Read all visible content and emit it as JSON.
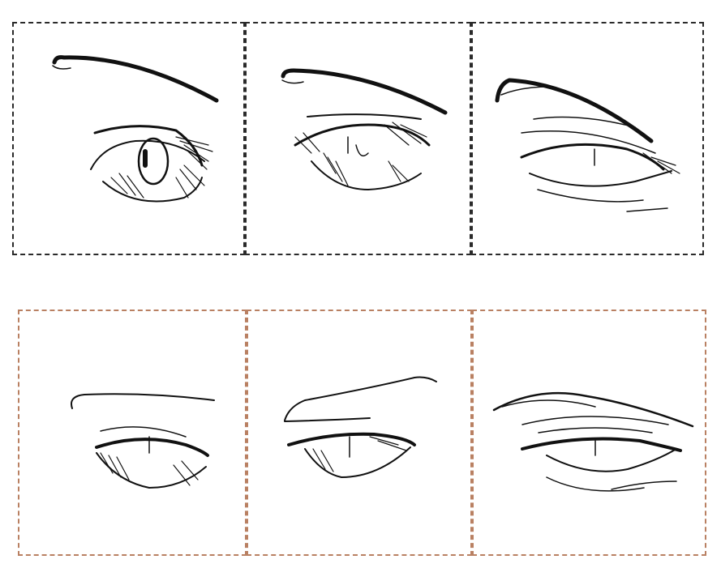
{
  "panels": [
    {
      "name": "eye-sketch-1",
      "row": "top",
      "description_icon": "eye-icon"
    },
    {
      "name": "eye-sketch-2",
      "row": "top",
      "description_icon": "eye-icon"
    },
    {
      "name": "eye-sketch-3",
      "row": "top",
      "description_icon": "eye-icon"
    },
    {
      "name": "eye-sketch-4",
      "row": "bottom",
      "description_icon": "eye-icon"
    },
    {
      "name": "eye-sketch-5",
      "row": "bottom",
      "description_icon": "eye-icon"
    },
    {
      "name": "eye-sketch-6",
      "row": "bottom",
      "description_icon": "eye-icon"
    }
  ],
  "colors": {
    "top_border": "#2a2a2a",
    "bottom_border": "#b98062",
    "ink": "#111111",
    "background": "#ffffff"
  }
}
